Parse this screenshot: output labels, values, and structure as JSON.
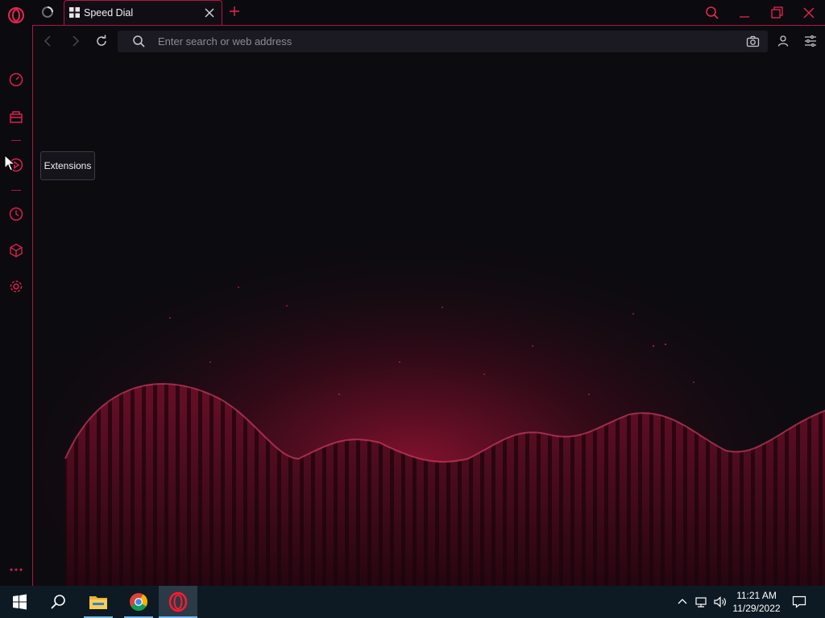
{
  "browser": {
    "tabs": [
      {
        "title": ""
      },
      {
        "title": "Speed Dial",
        "active": true
      }
    ],
    "address_bar": {
      "value": "",
      "placeholder": "Enter search or web address"
    },
    "accent_color": "#b1163f"
  },
  "sidebar": {
    "items": [
      {
        "name": "speed-dial",
        "icon": "gauge-icon"
      },
      {
        "name": "shopping",
        "icon": "bag-icon"
      },
      {
        "name": "extensions",
        "icon": "extensions-icon"
      },
      {
        "name": "history",
        "icon": "clock-icon"
      },
      {
        "name": "extensions-store",
        "icon": "cube-icon"
      },
      {
        "name": "settings",
        "icon": "gear-icon"
      }
    ],
    "tooltip": "Extensions",
    "more": "..."
  },
  "taskbar": {
    "apps": [
      {
        "name": "start",
        "icon": "windows-icon"
      },
      {
        "name": "search",
        "icon": "search-icon"
      },
      {
        "name": "file-explorer",
        "icon": "folder-icon"
      },
      {
        "name": "chrome",
        "icon": "chrome-icon"
      },
      {
        "name": "opera",
        "icon": "opera-icon",
        "active": true
      }
    ],
    "tray": {
      "time": "11:21 AM",
      "date": "11/29/2022"
    }
  }
}
